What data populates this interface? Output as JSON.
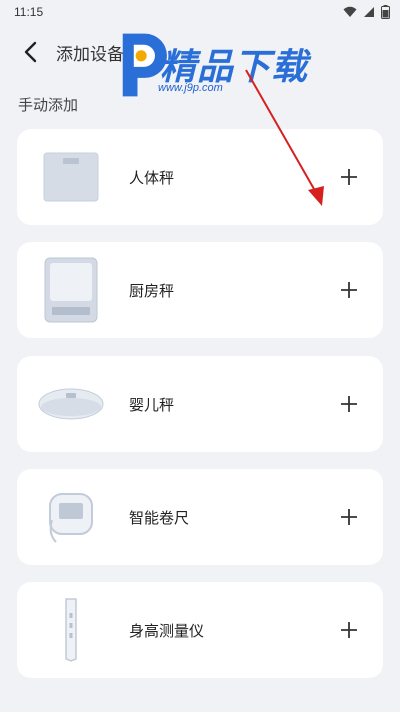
{
  "status": {
    "time": "11:15"
  },
  "header": {
    "title": "添加设备"
  },
  "section": {
    "label": "手动添加"
  },
  "devices": [
    {
      "name": "人体秤",
      "icon": "body-scale"
    },
    {
      "name": "厨房秤",
      "icon": "kitchen-scale"
    },
    {
      "name": "婴儿秤",
      "icon": "baby-scale"
    },
    {
      "name": "智能卷尺",
      "icon": "smart-tape"
    },
    {
      "name": "身高测量仪",
      "icon": "height-meter"
    }
  ],
  "watermark": {
    "brand": "精品下载",
    "url": "www.j9p.com"
  },
  "colors": {
    "background": "#f0f2f5",
    "card": "#ffffff",
    "watermark": "#2a6fd8",
    "arrow": "#d62020"
  }
}
